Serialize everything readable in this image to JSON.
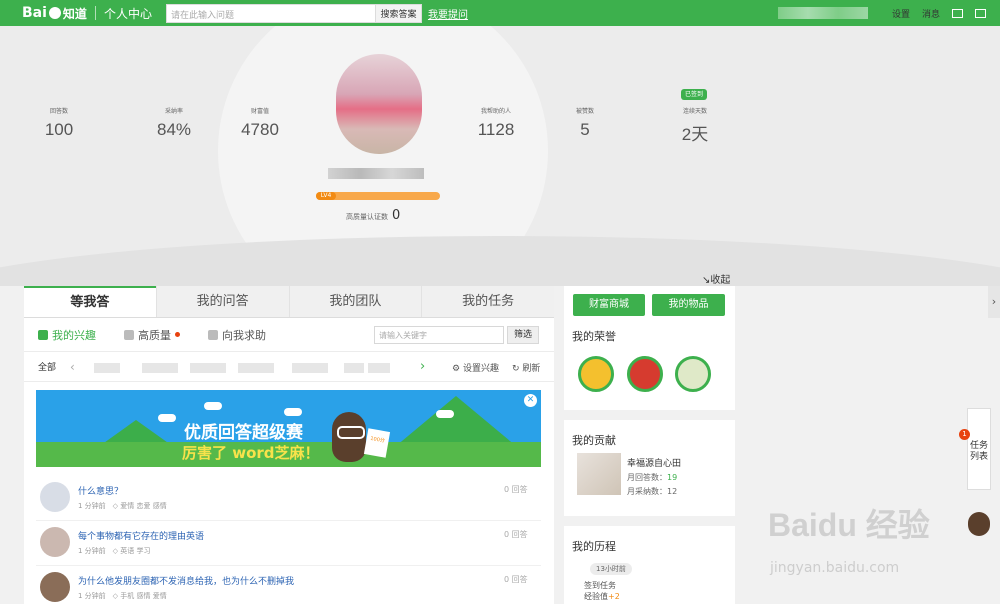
{
  "topbar": {
    "logo": "Bai",
    "logo_sub": "知道",
    "center": "个人中心",
    "search_placeholder": "请在此输入问题",
    "search_button": "搜索答案",
    "ask": "我要提问",
    "settings": "设置",
    "messages": "消息"
  },
  "stats": [
    {
      "label": "回答数",
      "value": "100"
    },
    {
      "label": "采纳率",
      "value": "84%"
    },
    {
      "label": "财富值",
      "value": "4780"
    },
    {
      "label": "我帮助的人",
      "value": "1128"
    },
    {
      "label": "被赞数",
      "value": "5"
    },
    {
      "label": "连续天数",
      "value": "2天"
    }
  ],
  "profile": {
    "level": "LV4",
    "level_progress": 0.92,
    "quality_label": "高质量认证数",
    "quality_count": "0",
    "signed_badge": "已签到"
  },
  "collapse": "↘收起",
  "tabs": [
    "等我答",
    "我的问答",
    "我的团队",
    "我的任务"
  ],
  "subtabs": [
    "我的兴趣",
    "高质量",
    "向我求助"
  ],
  "keyword_placeholder": "请输入关键字",
  "filter": "筛选",
  "category_all": "全部",
  "set_interest": "设置兴趣",
  "refresh": "刷新",
  "banner": {
    "title": "优质回答超级赛",
    "subtitle": "厉害了 word芝麻！",
    "paper": "100分"
  },
  "questions": [
    {
      "title": "什么意思？",
      "time": "1 分钟前",
      "tags": "爱情  恋爱  感情",
      "count": "0 回答"
    },
    {
      "title": "每个事物都有它存在的理由英语",
      "time": "1 分钟前",
      "tags": "英语  学习",
      "count": "0 回答"
    },
    {
      "title": "为什么他发朋友圈都不发消息给我，也为什么不删掉我",
      "time": "1 分钟前",
      "tags": "手机  感情  爱情",
      "count": "0 回答"
    }
  ],
  "right": {
    "mall": "财富商城",
    "items": "我的物品",
    "honor": "我的荣誉",
    "contribution": "我的贡献",
    "contrib_name": "幸福源自心田",
    "month_answers_label": "月回答数：",
    "month_answers": "19",
    "month_adopted_label": "月采纳数：",
    "month_adopted": "12",
    "history": "我的历程",
    "history_time": "13小时前",
    "history_task": "签到任务",
    "history_exp_label": "经验值",
    "history_exp": "+2"
  },
  "side_float": "任务列表",
  "side_badge": "1",
  "watermark": "Baidu 经验",
  "watermark_sub": "jingyan.baidu.com"
}
